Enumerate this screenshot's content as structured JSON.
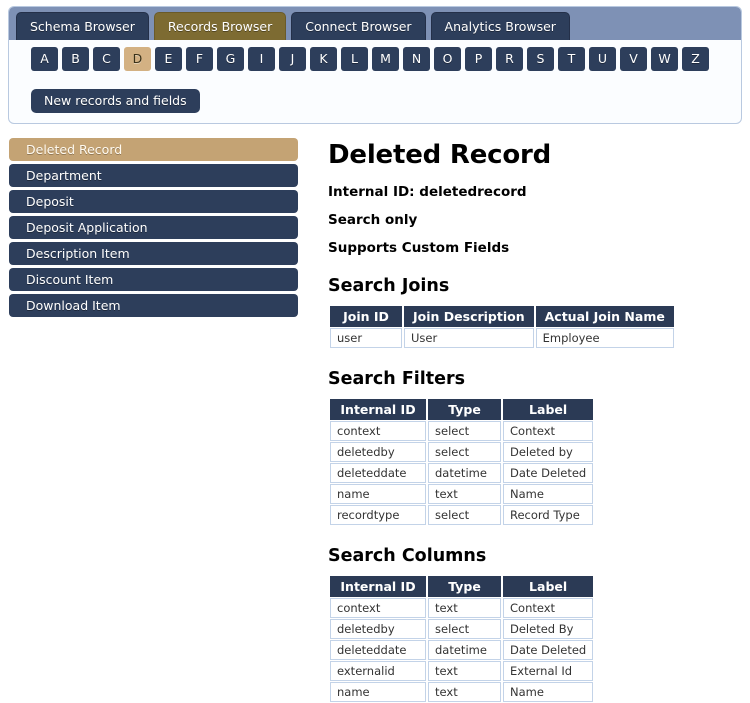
{
  "browser_panel": {
    "tabs": [
      {
        "label": "Schema Browser",
        "selected": false
      },
      {
        "label": "Records Browser",
        "selected": true
      },
      {
        "label": "Connect Browser",
        "selected": false
      },
      {
        "label": "Analytics Browser",
        "selected": false
      }
    ],
    "alphabet": [
      {
        "label": "A",
        "selected": false
      },
      {
        "label": "B",
        "selected": false
      },
      {
        "label": "C",
        "selected": false
      },
      {
        "label": "D",
        "selected": true
      },
      {
        "label": "E",
        "selected": false
      },
      {
        "label": "F",
        "selected": false
      },
      {
        "label": "G",
        "selected": false
      },
      {
        "label": "I",
        "selected": false
      },
      {
        "label": "J",
        "selected": false
      },
      {
        "label": "K",
        "selected": false
      },
      {
        "label": "L",
        "selected": false
      },
      {
        "label": "M",
        "selected": false
      },
      {
        "label": "N",
        "selected": false
      },
      {
        "label": "O",
        "selected": false
      },
      {
        "label": "P",
        "selected": false
      },
      {
        "label": "R",
        "selected": false
      },
      {
        "label": "S",
        "selected": false
      },
      {
        "label": "T",
        "selected": false
      },
      {
        "label": "U",
        "selected": false
      },
      {
        "label": "V",
        "selected": false
      },
      {
        "label": "W",
        "selected": false
      },
      {
        "label": "Z",
        "selected": false
      }
    ],
    "new_records_button": "New records and fields"
  },
  "sidebar": {
    "items": [
      {
        "label": "Deleted Record",
        "selected": true
      },
      {
        "label": "Department",
        "selected": false
      },
      {
        "label": "Deposit",
        "selected": false
      },
      {
        "label": "Deposit Application",
        "selected": false
      },
      {
        "label": "Description Item",
        "selected": false
      },
      {
        "label": "Discount Item",
        "selected": false
      },
      {
        "label": "Download Item",
        "selected": false
      }
    ]
  },
  "main": {
    "title": "Deleted Record",
    "internal_id_line": "Internal ID: deletedrecord",
    "search_only_line": "Search only",
    "custom_fields_line": "Supports Custom Fields",
    "search_joins": {
      "heading": "Search Joins",
      "columns": [
        "Join ID",
        "Join Description",
        "Actual Join Name"
      ],
      "rows": [
        [
          "user",
          "User",
          "Employee"
        ]
      ]
    },
    "search_filters": {
      "heading": "Search Filters",
      "columns": [
        "Internal ID",
        "Type",
        "Label"
      ],
      "rows": [
        [
          "context",
          "select",
          "Context"
        ],
        [
          "deletedby",
          "select",
          "Deleted by"
        ],
        [
          "deleteddate",
          "datetime",
          "Date Deleted"
        ],
        [
          "name",
          "text",
          "Name"
        ],
        [
          "recordtype",
          "select",
          "Record Type"
        ]
      ]
    },
    "search_columns": {
      "heading": "Search Columns",
      "columns": [
        "Internal ID",
        "Type",
        "Label"
      ],
      "rows": [
        [
          "context",
          "text",
          "Context"
        ],
        [
          "deletedby",
          "select",
          "Deleted By"
        ],
        [
          "deleteddate",
          "datetime",
          "Date Deleted"
        ],
        [
          "externalid",
          "text",
          "External Id"
        ],
        [
          "name",
          "text",
          "Name"
        ]
      ]
    }
  },
  "colors": {
    "tabstrip_bg": "#7e91b5",
    "tab_bg": "#2d3e5b",
    "tab_selected_bg": "#7d6b32",
    "alpha_selected_bg": "#d3b183",
    "sidebar_item_bg": "#2d3e5b",
    "sidebar_selected_bg": "#c4a374",
    "table_header_bg": "#2b3a55",
    "table_cell_border": "#c3d3e8",
    "panel_border": "#b9c9e0"
  }
}
